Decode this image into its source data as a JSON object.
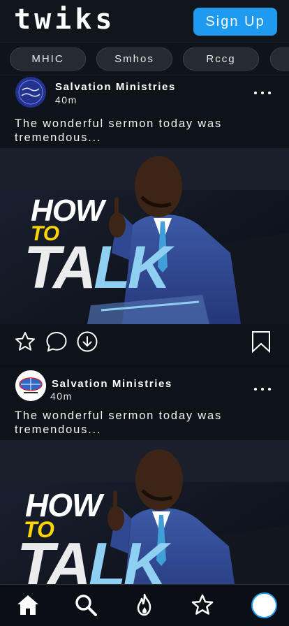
{
  "app": {
    "logo": "twiks",
    "signup_label": "Sign Up",
    "accent": "#1e9bf0"
  },
  "tabs": [
    {
      "label": "MHIC"
    },
    {
      "label": "Smhos"
    },
    {
      "label": "Rccg"
    },
    {
      "label": ""
    }
  ],
  "posts": [
    {
      "author": "Salvation Ministries",
      "time": "40m",
      "caption": "The wonderful sermon today was tremendous...",
      "avatar_icon": "clever-scientist-logo",
      "media": {
        "line1": "HOW",
        "line2": "TO",
        "line3a": "TA",
        "line3b": "LK"
      }
    },
    {
      "author": "Salvation Ministries",
      "time": "40m",
      "caption": "The wonderful sermon today was tremendous...",
      "avatar_icon": "salvation-ministries-logo",
      "media": {
        "line1": "HOW",
        "line2": "TO",
        "line3a": "TA",
        "line3b": "LK"
      }
    }
  ],
  "bottom_nav": [
    "home-icon",
    "search-icon",
    "fire-icon",
    "star-icon",
    "profile-avatar"
  ]
}
